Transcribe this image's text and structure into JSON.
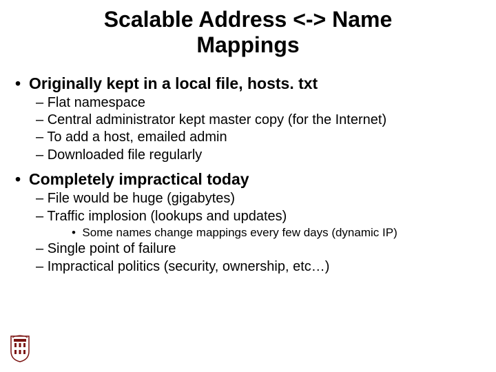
{
  "title_line_1": "Scalable Address <-> Name",
  "title_line_2": "Mappings",
  "b1": "Originally kept in a local file, hosts. txt",
  "b1_s1": "Flat namespace",
  "b1_s2": "Central administrator kept master copy (for the Internet)",
  "b1_s3": "To add a host, emailed admin",
  "b1_s4": "Downloaded file regularly",
  "b2": "Completely impractical today",
  "b2_s1": "File would be huge (gigabytes)",
  "b2_s2": "Traffic implosion (lookups and updates)",
  "b2_s2_a": "Some names change mappings every few days (dynamic IP)",
  "b2_s3": "Single point of failure",
  "b2_s4": "Impractical politics (security, ownership, etc…)"
}
